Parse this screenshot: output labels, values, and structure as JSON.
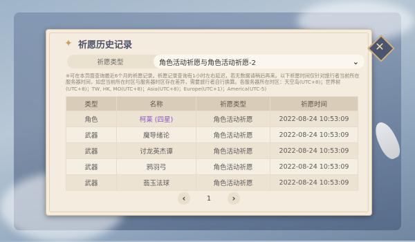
{
  "window": {
    "title": "祈愿历史记录",
    "close_icon": "✕",
    "title_icon": "✦"
  },
  "filter": {
    "label": "祈愿类型",
    "selected": "角色活动祈愿与角色活动祈愿-2",
    "chevron_icon": "⌄"
  },
  "notice": "※可在本页面查询最近6个月的祈愿记录。祈愿记录查询有1小时左右延迟，若无数据请稍后再来。以下祈愿时间仅针对旅行者当前所在服务器时间，如您当前所在时区与服务器时区存在差异，需要旅行者自行换算。各服务器所在时区：天空岛(UTC+8)；世界树(UTC+8)；TW, HK, MO(UTC+8)；Asia(UTC+8)；Europe(UTC+1)；America(UTC-5)",
  "table": {
    "headers": [
      "类型",
      "名称",
      "祈愿类型",
      "祈愿时间"
    ],
    "rows": [
      {
        "type": "角色",
        "name": "柯莱 (四星)",
        "wish": "角色活动祈愿",
        "time": "2022-08-24 10:53:09"
      },
      {
        "type": "武器",
        "name": "魔导绪论",
        "wish": "角色活动祈愿",
        "time": "2022-08-24 10:53:09"
      },
      {
        "type": "武器",
        "name": "讨龙英杰谭",
        "wish": "角色活动祈愿",
        "time": "2022-08-24 10:53:09"
      },
      {
        "type": "武器",
        "name": "鸦羽弓",
        "wish": "角色活动祈愿",
        "time": "2022-08-24 10:53:09"
      },
      {
        "type": "武器",
        "name": "翡玉法球",
        "wish": "角色活动祈愿",
        "time": "2022-08-24 10:53:09"
      }
    ]
  },
  "pager": {
    "prev_icon": "‹",
    "page": "1",
    "next_icon": "›"
  },
  "colors": {
    "highlight_name": "#8a57c7",
    "panel": "#f4ecdf",
    "close_bg": "#4a5670"
  }
}
